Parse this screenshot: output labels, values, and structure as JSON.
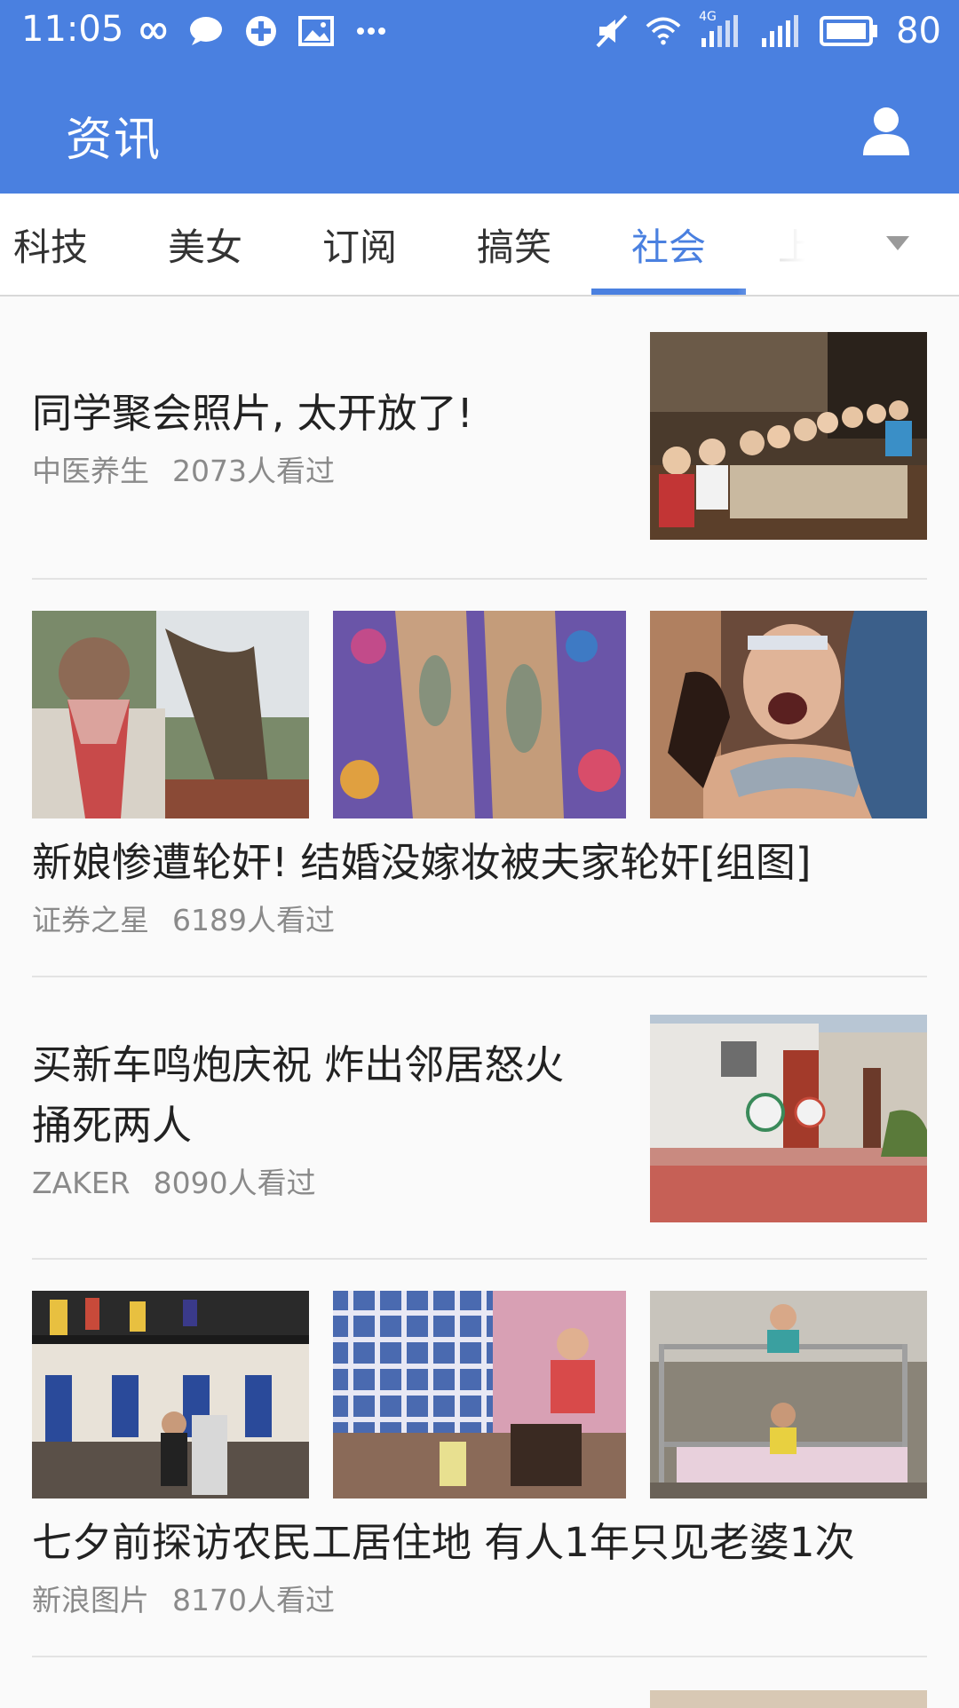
{
  "status_bar": {
    "time": "11:05",
    "network": "4G",
    "battery": "80",
    "icons": [
      "infinity-icon",
      "chat-bubble-icon",
      "sync-icon",
      "image-icon",
      "more-dots-icon",
      "mute-icon",
      "wifi-icon",
      "signal-4g-icon",
      "signal-icon",
      "battery-icon"
    ]
  },
  "appbar": {
    "title": "资讯"
  },
  "tabs": [
    {
      "label": "科技"
    },
    {
      "label": "美女"
    },
    {
      "label": "订阅"
    },
    {
      "label": "搞笑"
    },
    {
      "label": "社会",
      "active": true
    },
    {
      "label": "上"
    }
  ],
  "accent_color": "#4a80e0",
  "feed": [
    {
      "title": "同学聚会照片, 太开放了!",
      "source": "中医养生",
      "views": "2073人看过",
      "layout": "single"
    },
    {
      "title": "新娘惨遭轮奸! 结婚没嫁妆被夫家轮奸[组图]",
      "source": "证券之星",
      "views": "6189人看过",
      "layout": "triple"
    },
    {
      "title": "买新车鸣炮庆祝 炸出邻居怒火捅死两人",
      "source": "ZAKER",
      "views": "8090人看过",
      "layout": "single"
    },
    {
      "title": "七夕前探访农民工居住地 有人1年只见老婆1次",
      "source": "新浪图片",
      "views": "8170人看过",
      "layout": "triple"
    }
  ]
}
